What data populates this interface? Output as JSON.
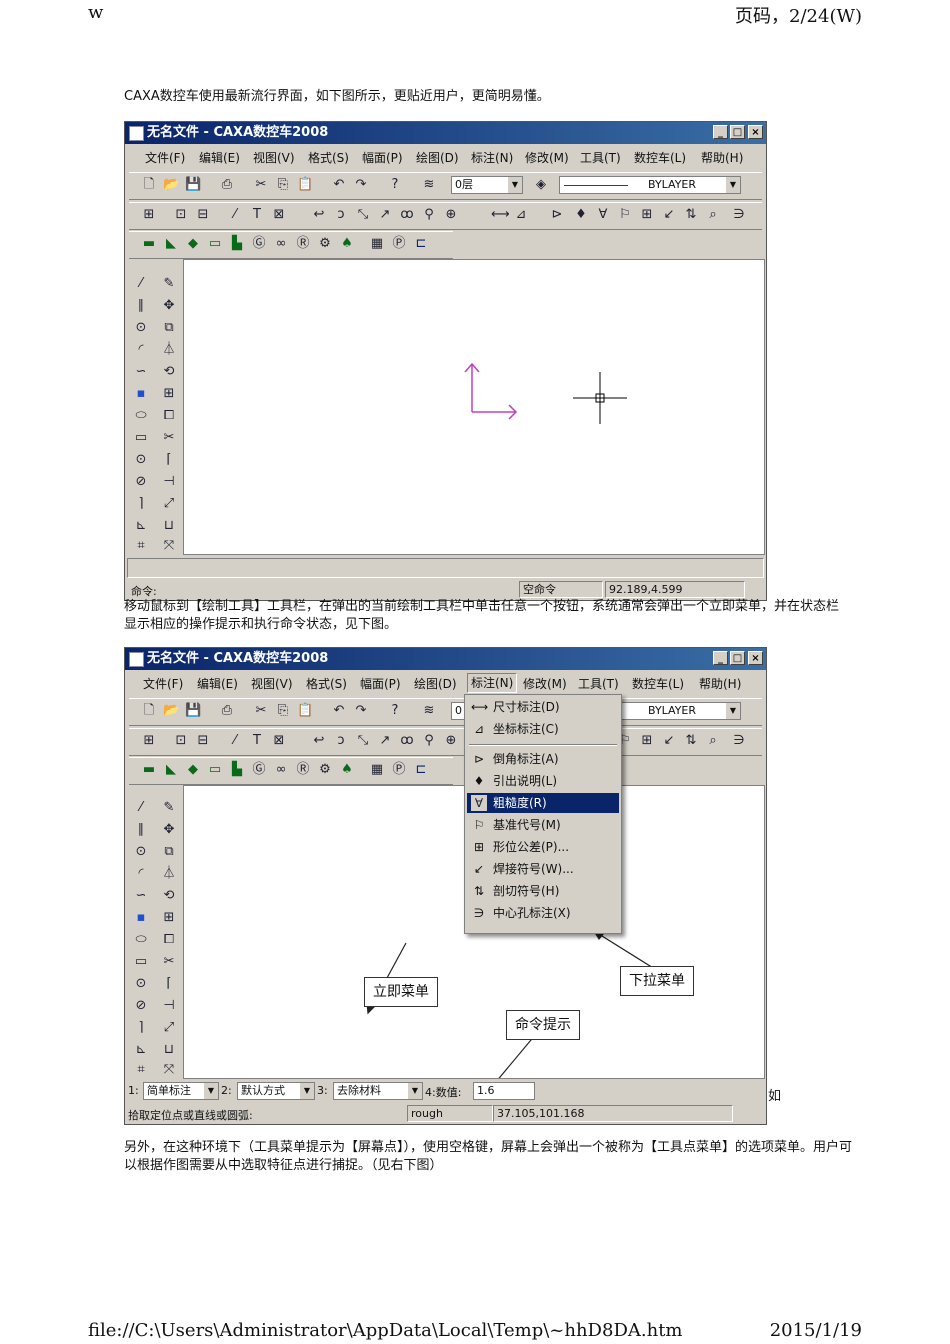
{
  "header": {
    "left": "w",
    "right": "页码，2/24(W)"
  },
  "intro": "CAXA数控车使用最新流行界面，如下图所示，更贴近用户，更简明易懂。",
  "window1": {
    "title": "无名文件 - CAXA数控车2008",
    "window_buttons": [
      "_",
      "□",
      "×"
    ],
    "menus": [
      "文件(F)",
      "编辑(E)",
      "视图(V)",
      "格式(S)",
      "幅面(P)",
      "绘图(D)",
      "标注(N)",
      "修改(M)",
      "工具(T)",
      "数控车(L)",
      "帮助(H)"
    ],
    "layer": "0层",
    "linetype": "BYLAYER",
    "status": {
      "command": "命令:",
      "mode": "空命令",
      "coords": "92.189,4.599"
    }
  },
  "para2": "移动鼠标到【绘制工具】工具栏，在弹出的当前绘制工具栏中单击任意一个按钮，系统通常会弹出一个立即菜单，并在状态栏显示相应的操作提示和执行命令状态，见下图。",
  "window2": {
    "title": "无名文件 - CAXA数控车2008",
    "window_buttons": [
      "_",
      "□",
      "×"
    ],
    "menus": [
      "文件(F)",
      "编辑(E)",
      "视图(V)",
      "格式(S)",
      "幅面(P)",
      "绘图(D)",
      "标注(N)",
      "修改(M)",
      "工具(T)",
      "数控车(L)",
      "帮助(H)"
    ],
    "layer": "0",
    "linetype": "BYLAYER",
    "dropdown": [
      "尺寸标注(D)",
      "坐标标注(C)",
      "倒角标注(A)",
      "引出说明(L)",
      "粗糙度(R)",
      "基准代号(M)",
      "形位公差(P)...",
      "焊接符号(W)...",
      "剖切符号(H)",
      "中心孔标注(X)"
    ],
    "dropdown_selected": 4,
    "callouts": {
      "immediate": "立即菜单",
      "dropdown": "下拉菜单",
      "prompt": "命令提示"
    },
    "immediate_menu": {
      "f1_num": "1:",
      "f1": "简单标注",
      "f2_num": "2:",
      "f2": "默认方式",
      "f3_num": "3:",
      "f3": "去除材料",
      "f4_label": "4:数值:",
      "f4": "1.6"
    },
    "status": {
      "prompt": "拾取定位点或直线或圆弧:",
      "mode": "rough",
      "coords": "37.105,101.168"
    }
  },
  "stray_char": "如",
  "para3": "另外，在这种环境下（工具菜单提示为【屏幕点】），使用空格键，屏幕上会弹出一个被称为【工具点菜单】的选项菜单。用户可以根据作图需要从中选取特征点进行捕捉。（见右下图）",
  "footer": {
    "left": "file://C:\\Users\\Administrator\\AppData\\Local\\Temp\\~hhD8DA.htm",
    "right": "2015/1/19"
  },
  "colors": {
    "titlebar": "#0a246a",
    "axis": "#c040c0",
    "selected": "#0a246a",
    "linetype": "#cc0000"
  }
}
